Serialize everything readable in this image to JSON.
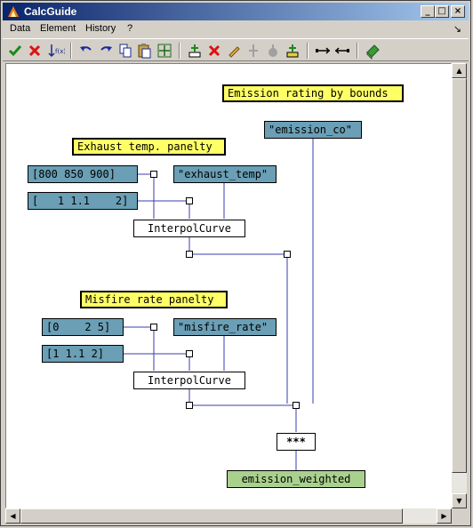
{
  "window": {
    "title": "CalcGuide"
  },
  "title_buttons": {
    "minimize": "_",
    "maximize": "□",
    "close": "×"
  },
  "menu": {
    "items": [
      "Data",
      "Element",
      "History",
      "?"
    ],
    "pin": "↘"
  },
  "toolbar": {
    "icons": [
      "check-icon",
      "cross-icon",
      "sort-fx-icon",
      "undo-icon",
      "redo-icon",
      "copy-icon",
      "paste-icon",
      "fit-icon",
      "add-element-icon",
      "delete-element-icon",
      "edit-icon",
      "split-icon",
      "merge-icon",
      "add-below-icon",
      "expand-icon",
      "collapse-icon",
      "book-icon"
    ]
  },
  "colors": {
    "note": "#ffff66",
    "input": "#6a9fb5",
    "output": "#a9d18e",
    "wire": "#3b3bb0"
  },
  "diagram": {
    "notes": {
      "emission_rating": "Emission rating by bounds",
      "exhaust_penalty": "Exhaust temp. panelty",
      "misfire_penalty": "Misfire rate panelty"
    },
    "inputs": {
      "emission_co": "\"emission_co\"",
      "exhaust_bounds": "[800 850 900]",
      "exhaust_factors": "[   1 1.1    2]",
      "exhaust_temp": "\"exhaust_temp\"",
      "misfire_bounds": "[0    2 5]",
      "misfire_factors": "[1 1.1 2]",
      "misfire_rate": "\"misfire_rate\""
    },
    "functions": {
      "interpol_1": "InterpolCurve",
      "interpol_2": "InterpolCurve",
      "multiply": "***"
    },
    "output": "emission_weighted"
  },
  "scrollbars": {
    "up": "▲",
    "down": "▼",
    "left": "◀",
    "right": "▶"
  }
}
